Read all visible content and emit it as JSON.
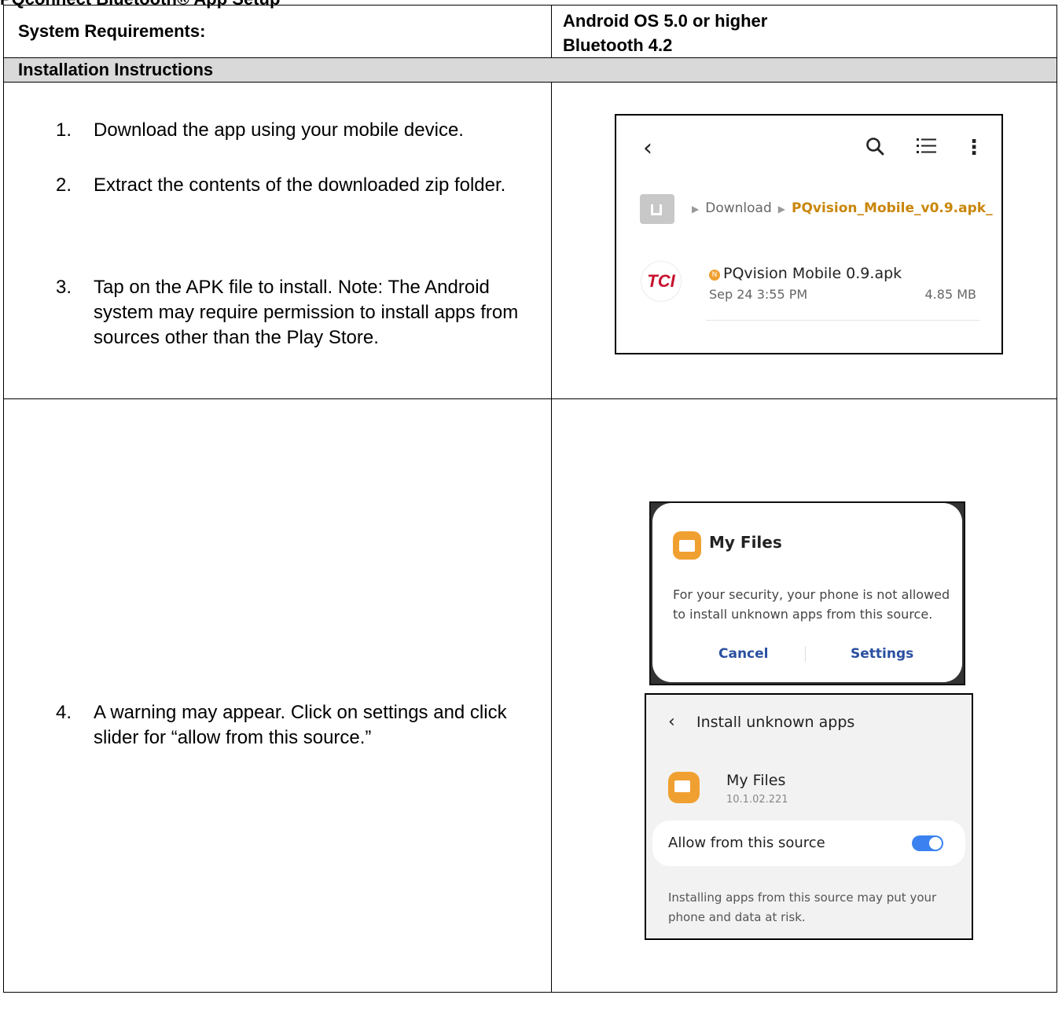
{
  "page_heading": "PQconnect Bluetooth® App Setup",
  "requirements": {
    "label": "System Requirements:",
    "os": "Android OS 5.0 or higher",
    "bluetooth": "Bluetooth 4.2"
  },
  "section_title": "Installation Instructions",
  "steps": [
    {
      "num": "1.",
      "text": "Download the app using your mobile device."
    },
    {
      "num": "2.",
      "text": "Extract the contents of the downloaded zip folder."
    },
    {
      "num": "3.",
      "text": "Tap on the APK file to install. Note: The Android system may require permission to install apps from sources other than the Play Store."
    },
    {
      "num": "4.",
      "text": "A warning may appear. Click on settings and click slider for “allow from this source.”"
    }
  ],
  "file_browser": {
    "back_glyph": "‹",
    "more_glyph": "⋮",
    "breadcrumb_folder": "Download",
    "breadcrumb_current": "PQvision_Mobile_v0.9.apk_",
    "logo_text": "TCI",
    "badge_letter": "N",
    "file_name": "PQvision Mobile 0.9.apk",
    "file_date": "Sep 24 3:55 PM",
    "file_size": "4.85 MB",
    "icons": [
      "back-icon",
      "search-icon",
      "list-view-icon",
      "more-options-icon",
      "home-icon"
    ]
  },
  "security_dialog": {
    "title": "My Files",
    "message": "For your security, your phone is not allowed to install unknown apps from this source.",
    "cancel_label": "Cancel",
    "settings_label": "Settings",
    "accent_color": "#2a4fa0"
  },
  "install_unknown": {
    "back_glyph": "‹",
    "title": "Install unknown apps",
    "app_name": "My Files",
    "app_version": "10.1.02.221",
    "allow_label": "Allow from this source",
    "allow_enabled": true,
    "warning": "Installing apps from this source may put your phone and data at risk.",
    "toggle_color": "#3b82f0"
  }
}
